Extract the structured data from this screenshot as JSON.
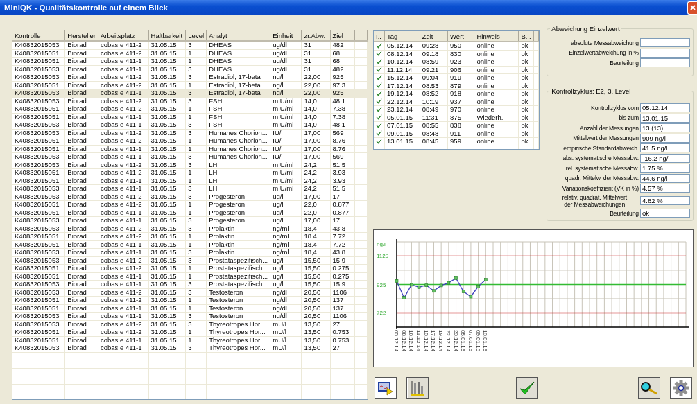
{
  "window": {
    "title": "MiniQK - Qualitätskontrolle auf einem Blick"
  },
  "controls_table": {
    "columns": [
      "Kontrolle",
      "Hersteller",
      "Arbeitsplatz",
      "Haltbarkeit",
      "Level",
      "Analyt",
      "Einheit",
      "zr.Abw.",
      "Ziel"
    ],
    "rows": [
      {
        "cells": [
          "K40832015053",
          "Biorad",
          "cobas e 411-2",
          "31.05.15",
          "3",
          "DHEAS",
          "ug/dl",
          "31",
          "482"
        ],
        "selected": false
      },
      {
        "cells": [
          "K40832015051",
          "Biorad",
          "cobas e 411-2",
          "31.05.15",
          "1",
          "DHEAS",
          "ug/dl",
          "31",
          "68"
        ],
        "selected": false
      },
      {
        "cells": [
          "K40832015051",
          "Biorad",
          "cobas e 411-1",
          "31.05.15",
          "1",
          "DHEAS",
          "ug/dl",
          "31",
          "68"
        ],
        "selected": false
      },
      {
        "cells": [
          "K40832015053",
          "Biorad",
          "cobas e 411-1",
          "31.05.15",
          "3",
          "DHEAS",
          "ug/dl",
          "31",
          "482"
        ],
        "selected": false
      },
      {
        "cells": [
          "K40832015053",
          "Biorad",
          "cobas e 411-2",
          "31.05.15",
          "3",
          "Estradiol, 17-beta",
          "ng/l",
          "22,00",
          "925"
        ],
        "selected": false
      },
      {
        "cells": [
          "K40832015051",
          "Biorad",
          "cobas e 411-2",
          "31.05.15",
          "1",
          "Estradiol, 17-beta",
          "ng/l",
          "22,00",
          "97,3"
        ],
        "selected": false
      },
      {
        "cells": [
          "K40832015053",
          "Biorad",
          "cobas e 411-1",
          "31.05.15",
          "3",
          "Estradiol, 17-beta",
          "ng/l",
          "22,00",
          "925"
        ],
        "selected": true
      },
      {
        "cells": [
          "K40832015053",
          "Biorad",
          "cobas e 411-2",
          "31.05.15",
          "3",
          "FSH",
          "mIU/ml",
          "14,0",
          "48,1"
        ],
        "selected": false
      },
      {
        "cells": [
          "K40832015051",
          "Biorad",
          "cobas e 411-2",
          "31.05.15",
          "1",
          "FSH",
          "mIU/ml",
          "14,0",
          "7.38"
        ],
        "selected": false
      },
      {
        "cells": [
          "K40832015051",
          "Biorad",
          "cobas e 411-1",
          "31.05.15",
          "1",
          "FSH",
          "mIU/ml",
          "14,0",
          "7.38"
        ],
        "selected": false
      },
      {
        "cells": [
          "K40832015053",
          "Biorad",
          "cobas e 411-1",
          "31.05.15",
          "3",
          "FSH",
          "mIU/ml",
          "14,0",
          "48,1"
        ],
        "selected": false
      },
      {
        "cells": [
          "K40832015053",
          "Biorad",
          "cobas e 411-2",
          "31.05.15",
          "3",
          "Humanes Chorion...",
          "IU/l",
          "17,00",
          "569"
        ],
        "selected": false
      },
      {
        "cells": [
          "K40832015051",
          "Biorad",
          "cobas e 411-2",
          "31.05.15",
          "1",
          "Humanes Chorion...",
          "IU/l",
          "17,00",
          "8.76"
        ],
        "selected": false
      },
      {
        "cells": [
          "K40832015051",
          "Biorad",
          "cobas e 411-1",
          "31.05.15",
          "1",
          "Humanes Chorion...",
          "IU/l",
          "17,00",
          "8.76"
        ],
        "selected": false
      },
      {
        "cells": [
          "K40832015053",
          "Biorad",
          "cobas e 411-1",
          "31.05.15",
          "3",
          "Humanes Chorion...",
          "IU/l",
          "17,00",
          "569"
        ],
        "selected": false
      },
      {
        "cells": [
          "K40832015053",
          "Biorad",
          "cobas e 411-2",
          "31.05.15",
          "3",
          "LH",
          "mIU/ml",
          "24,2",
          "51.5"
        ],
        "selected": false
      },
      {
        "cells": [
          "K40832015051",
          "Biorad",
          "cobas e 411-2",
          "31.05.15",
          "1",
          "LH",
          "mIU/ml",
          "24,2",
          "3.93"
        ],
        "selected": false
      },
      {
        "cells": [
          "K40832015051",
          "Biorad",
          "cobas e 411-1",
          "31.05.15",
          "1",
          "LH",
          "mIU/ml",
          "24,2",
          "3.93"
        ],
        "selected": false
      },
      {
        "cells": [
          "K40832015053",
          "Biorad",
          "cobas e 411-1",
          "31.05.15",
          "3",
          "LH",
          "mIU/ml",
          "24,2",
          "51.5"
        ],
        "selected": false
      },
      {
        "cells": [
          "K40832015053",
          "Biorad",
          "cobas e 411-2",
          "31.05.15",
          "3",
          "Progesteron",
          "ug/l",
          "17,00",
          "17"
        ],
        "selected": false
      },
      {
        "cells": [
          "K40832015051",
          "Biorad",
          "cobas e 411-2",
          "31.05.15",
          "1",
          "Progesteron",
          "ug/l",
          "22,0",
          "0.877"
        ],
        "selected": false
      },
      {
        "cells": [
          "K40832015051",
          "Biorad",
          "cobas e 411-1",
          "31.05.15",
          "1",
          "Progesteron",
          "ug/l",
          "22,0",
          "0.877"
        ],
        "selected": false
      },
      {
        "cells": [
          "K40832015053",
          "Biorad",
          "cobas e 411-1",
          "31.05.15",
          "3",
          "Progesteron",
          "ug/l",
          "17,00",
          "17"
        ],
        "selected": false
      },
      {
        "cells": [
          "K40832015053",
          "Biorad",
          "cobas e 411-2",
          "31.05.15",
          "3",
          "Prolaktin",
          "ng/ml",
          "18,4",
          "43.8"
        ],
        "selected": false
      },
      {
        "cells": [
          "K40832015051",
          "Biorad",
          "cobas e 411-2",
          "31.05.15",
          "1",
          "Prolaktin",
          "ng/ml",
          "18.4",
          "7.72"
        ],
        "selected": false
      },
      {
        "cells": [
          "K40832015051",
          "Biorad",
          "cobas e 411-1",
          "31.05.15",
          "1",
          "Prolaktin",
          "ng/ml",
          "18.4",
          "7.72"
        ],
        "selected": false
      },
      {
        "cells": [
          "K40832015053",
          "Biorad",
          "cobas e 411-1",
          "31.05.15",
          "3",
          "Prolaktin",
          "ng/ml",
          "18,4",
          "43.8"
        ],
        "selected": false
      },
      {
        "cells": [
          "K40832015053",
          "Biorad",
          "cobas e 411-2",
          "31.05.15",
          "3",
          "Prostataspezifisch...",
          "ug/l",
          "15,50",
          "15.9"
        ],
        "selected": false
      },
      {
        "cells": [
          "K40832015051",
          "Biorad",
          "cobas e 411-2",
          "31.05.15",
          "1",
          "Prostataspezifisch...",
          "ug/l",
          "15,50",
          "0.275"
        ],
        "selected": false
      },
      {
        "cells": [
          "K40832015051",
          "Biorad",
          "cobas e 411-1",
          "31.05.15",
          "1",
          "Prostataspezifisch...",
          "ug/l",
          "15,50",
          "0.275"
        ],
        "selected": false
      },
      {
        "cells": [
          "K40832015053",
          "Biorad",
          "cobas e 411-1",
          "31.05.15",
          "3",
          "Prostataspezifisch...",
          "ug/l",
          "15,50",
          "15.9"
        ],
        "selected": false
      },
      {
        "cells": [
          "K40832015053",
          "Biorad",
          "cobas e 411-2",
          "31.05.15",
          "3",
          "Testosteron",
          "ng/dl",
          "20,50",
          "1106"
        ],
        "selected": false
      },
      {
        "cells": [
          "K40832015051",
          "Biorad",
          "cobas e 411-2",
          "31.05.15",
          "1",
          "Testosteron",
          "ng/dl",
          "20,50",
          "137"
        ],
        "selected": false
      },
      {
        "cells": [
          "K40832015051",
          "Biorad",
          "cobas e 411-1",
          "31.05.15",
          "1",
          "Testosteron",
          "ng/dl",
          "20,50",
          "137"
        ],
        "selected": false
      },
      {
        "cells": [
          "K40832015053",
          "Biorad",
          "cobas e 411-1",
          "31.05.15",
          "3",
          "Testosteron",
          "ng/dl",
          "20,50",
          "1106"
        ],
        "selected": false
      },
      {
        "cells": [
          "K40832015053",
          "Biorad",
          "cobas e 411-2",
          "31.05.15",
          "3",
          "Thyreotropes Hor...",
          "mU/l",
          "13,50",
          "27"
        ],
        "selected": false
      },
      {
        "cells": [
          "K40832015051",
          "Biorad",
          "cobas e 411-2",
          "31.05.15",
          "1",
          "Thyreotropes Hor...",
          "mU/l",
          "13,50",
          "0.753"
        ],
        "selected": false
      },
      {
        "cells": [
          "K40832015051",
          "Biorad",
          "cobas e 411-1",
          "31.05.15",
          "1",
          "Thyreotropes Hor...",
          "mU/l",
          "13,50",
          "0.753"
        ],
        "selected": false
      },
      {
        "cells": [
          "K40832015053",
          "Biorad",
          "cobas e 411-1",
          "31.05.15",
          "3",
          "Thyreotropes Hor...",
          "mU/l",
          "13,50",
          "27"
        ],
        "selected": false
      }
    ]
  },
  "measurements_table": {
    "columns": [
      "I..",
      "Tag",
      "Zeit",
      "Wert",
      "Hinweis",
      "B..."
    ],
    "rows": [
      {
        "cells": [
          "",
          "05.12.14",
          "09:28",
          "950",
          "online",
          "ok"
        ]
      },
      {
        "cells": [
          "",
          "08.12.14",
          "09:18",
          "830",
          "online",
          "ok"
        ]
      },
      {
        "cells": [
          "",
          "10.12.14",
          "08:59",
          "923",
          "online",
          "ok"
        ]
      },
      {
        "cells": [
          "",
          "11.12.14",
          "09:21",
          "906",
          "online",
          "ok"
        ]
      },
      {
        "cells": [
          "",
          "15.12.14",
          "09:04",
          "919",
          "online",
          "ok"
        ]
      },
      {
        "cells": [
          "",
          "17.12.14",
          "08:53",
          "879",
          "online",
          "ok"
        ]
      },
      {
        "cells": [
          "",
          "19.12.14",
          "08:52",
          "918",
          "online",
          "ok"
        ]
      },
      {
        "cells": [
          "",
          "22.12.14",
          "10:19",
          "937",
          "online",
          "ok"
        ]
      },
      {
        "cells": [
          "",
          "23.12.14",
          "08:49",
          "970",
          "online",
          "ok"
        ]
      },
      {
        "cells": [
          "",
          "05.01.15",
          "11:31",
          "875",
          "Wiederh.",
          "ok"
        ]
      },
      {
        "cells": [
          "",
          "07.01.15",
          "08:55",
          "838",
          "online",
          "ok"
        ]
      },
      {
        "cells": [
          "",
          "09.01.15",
          "08:48",
          "911",
          "online",
          "ok"
        ]
      },
      {
        "cells": [
          "",
          "13.01.15",
          "08:45",
          "959",
          "online",
          "ok"
        ]
      }
    ]
  },
  "single_value_group": {
    "title": "Abweichung Einzelwert",
    "fields": [
      {
        "label": "absolute Messabweichung"
      },
      {
        "label": "Einzelwertabweichung in %"
      },
      {
        "label": "Beurteilung"
      }
    ]
  },
  "cycle_group": {
    "title": "Kontrollzyklus: E2, 3. Level",
    "fields": [
      {
        "label": "Kontrollzyklus vom",
        "value": "05.12.14"
      },
      {
        "label": "bis zum",
        "value": "13.01.15"
      },
      {
        "label": "Anzahl der Messungen",
        "value": "13 (13)"
      },
      {
        "label": "Mittelwert der Messungen",
        "value": "909 ng/l"
      },
      {
        "label": "empirische Standardabweich.",
        "value": "41.5 ng/l"
      },
      {
        "label": "abs. systematische Messabw.",
        "value": "-16.2 ng/l"
      },
      {
        "label": "rel. systematische Messabw.",
        "value": "1.75 %"
      },
      {
        "label": "quadr. Mittelw. der Messabw.",
        "value": "44.6 ng/l"
      },
      {
        "label": "Variationskoeffizient (VK in %)",
        "value": "4.57 %"
      },
      {
        "label": "relativ. quadrat. Mittelwert\nder Messabweichungen",
        "value": "4.82 %"
      },
      {
        "label": "Beurteilung",
        "value": "ok"
      }
    ]
  },
  "chart": {
    "chart_data": {
      "type": "line",
      "ylabel": "ng/l",
      "categories": [
        "05.12.14",
        "08.12.14",
        "10.12.14",
        "11.12.14",
        "15.12.14",
        "17.12.14",
        "19.12.14",
        "22.12.14",
        "23.12.14",
        "05.01.15",
        "07.01.15",
        "09.01.15",
        "13.01.15"
      ],
      "series": [
        {
          "color": "#4040c0",
          "marker": "square",
          "values": [
            950,
            830,
            923,
            906,
            919,
            879,
            918,
            937,
            970,
            875,
            838,
            911,
            959
          ]
        }
      ],
      "ylim": [
        620,
        1230
      ],
      "yticks": [
        722,
        925,
        1129
      ],
      "grid": true,
      "ref_lines": [
        {
          "axis": "y",
          "value": 1129,
          "color": "#cc3333"
        },
        {
          "axis": "y",
          "value": 925,
          "color": "#33bb33"
        },
        {
          "axis": "y",
          "value": 722,
          "color": "#cc3333"
        }
      ]
    }
  }
}
